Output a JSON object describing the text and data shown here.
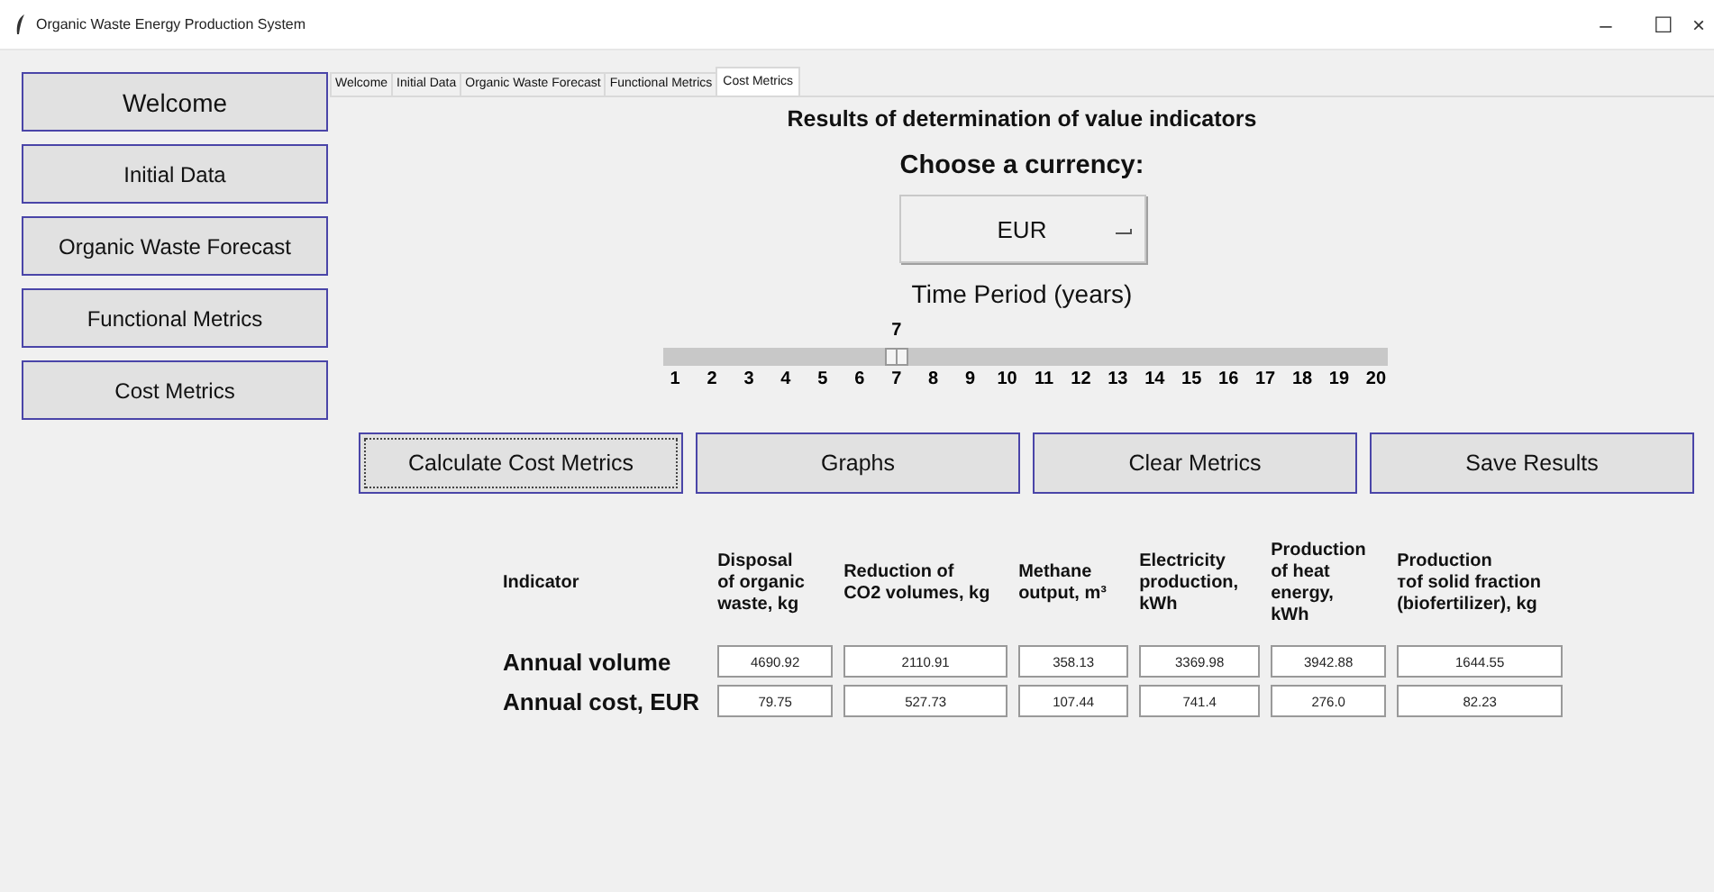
{
  "window": {
    "title": "Organic Waste Energy Production System",
    "controls": [
      "–",
      "☐",
      "×"
    ]
  },
  "sidebar": {
    "items": [
      {
        "label": "Welcome",
        "big": true
      },
      {
        "label": "Initial Data",
        "big": false
      },
      {
        "label": "Organic Waste Forecast",
        "big": false
      },
      {
        "label": "Functional Metrics",
        "big": false
      },
      {
        "label": "Cost Metrics",
        "big": false
      }
    ]
  },
  "tabs": [
    {
      "label": "Welcome",
      "selected": false
    },
    {
      "label": "Initial Data",
      "selected": false
    },
    {
      "label": "Organic Waste Forecast",
      "selected": false
    },
    {
      "label": "Functional Metrics",
      "selected": false
    },
    {
      "label": "Cost Metrics",
      "selected": true
    }
  ],
  "heading": "Results of determination of value indicators",
  "currency": {
    "label": "Choose a currency:",
    "value": "EUR"
  },
  "slider": {
    "label": "Time Period (years)",
    "value": "7",
    "level": 0.316,
    "ticks": [
      "1",
      "2",
      "3",
      "4",
      "5",
      "6",
      "7",
      "8",
      "9",
      "10",
      "11",
      "12",
      "13",
      "14",
      "15",
      "16",
      "17",
      "18",
      "19",
      "20"
    ]
  },
  "buttons": [
    {
      "label": "Calculate Cost Metrics",
      "focused": true
    },
    {
      "label": "Graphs",
      "focused": false
    },
    {
      "label": "Clear Metrics",
      "focused": false
    },
    {
      "label": "Save Results",
      "focused": false
    }
  ],
  "table": {
    "columns": [
      "Indicator",
      "Disposal\nof organic\nwaste, kg",
      "Reduction of\nCO2 volumes, kg",
      "Methane\noutput,  m³",
      "Electricity\nproduction,\nkWh",
      "Production\nof heat\nenergy,\nkWh",
      "Production\nтof solid fraction\n(biofertilizer), kg"
    ],
    "rows": [
      {
        "label": "Annual volume",
        "values": [
          "4690.92",
          "2110.91",
          "358.13",
          "3369.98",
          "3942.88",
          "1644.55"
        ]
      },
      {
        "label": "Annual cost, EUR",
        "values": [
          "79.75",
          "527.73",
          "107.44",
          "741.4",
          "276.0",
          "82.23"
        ]
      }
    ]
  }
}
